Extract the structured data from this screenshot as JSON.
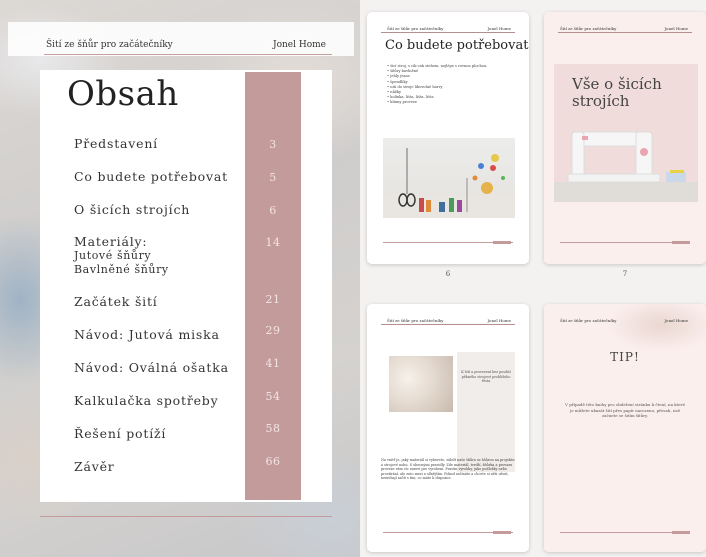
{
  "toc": {
    "header_left": "Šití ze šňůr pro začátečníky",
    "header_right": "Jonel Home",
    "title": "Obsah",
    "items": [
      {
        "label": "Představení",
        "page": "3"
      },
      {
        "label": "Co budete potřebovat",
        "page": "5"
      },
      {
        "label": "O šicích strojích",
        "page": "6"
      },
      {
        "label": "Materiály:",
        "sub1": "Jutové šňůry",
        "sub2": "Bavlněné šňůry",
        "page": "14"
      },
      {
        "label": "Začátek šití",
        "page": "21"
      },
      {
        "label": "Návod: Jutová miska",
        "page": "29"
      },
      {
        "label": "Návod: Oválná ošatka",
        "page": "41"
      },
      {
        "label": "Kalkulačka spotřeby",
        "page": "54"
      },
      {
        "label": "Řešení potíží",
        "page": "58"
      },
      {
        "label": "Závěr",
        "page": "66"
      }
    ],
    "accent_color": "#c49b9b"
  },
  "thumbs": [
    {
      "header_left": "Šití ze šňůr pro začátečníky",
      "header_right": "Jonel Home",
      "title": "Co budete potřebovat",
      "list": [
        "šicí stroj, s cik-cak stehem, nejlépe s rovnou plochou,",
        "šňůry bavlněné",
        "jehly jeans",
        "špendlíky",
        "niti do stroje libovolné barvy",
        "nůžky",
        "kolínka, lišta, lišta, lišta",
        "klinny proveze"
      ],
      "page_number": "6"
    },
    {
      "header_left": "Šití ze šňůr pro začátečníky",
      "header_right": "Jonel Home",
      "title_line1": "Vše o šicích",
      "title_line2": "strojích",
      "page_number": "7"
    },
    {
      "header_left": "Šití ze šňůr pro začátečníky",
      "header_right": "Jonel Home",
      "box_text": "K šití a provezení bez použití pěkného strojové prohlížeho těsta",
      "paragraph": "Na vnitř je, jaký materiál si vyberete, záleží naše šňůra se šňůrou na projektu a strojové nohu. S obecnými pravidly. Zde materiál, tvrdší, šňůrka a provazu proveze vám víc zaroví pro vyrobení. Pravím vyrobky, jako podložky nebo prostírání, ale zato mezi a sílnějším. Pokud začínáte a chcete si něti ušvat, nemvhají začít s tím, co máte k dispozici."
    },
    {
      "header_left": "Šití ze šňůr pro začátečníky",
      "header_right": "Jonel Home",
      "tip": "TIP!",
      "text": "V případě této knihy pro obdržení stránku k čtení, na které je můžete ukazát šití přes papír narozeno, přesah, než začnete se šitím šňůry."
    }
  ]
}
